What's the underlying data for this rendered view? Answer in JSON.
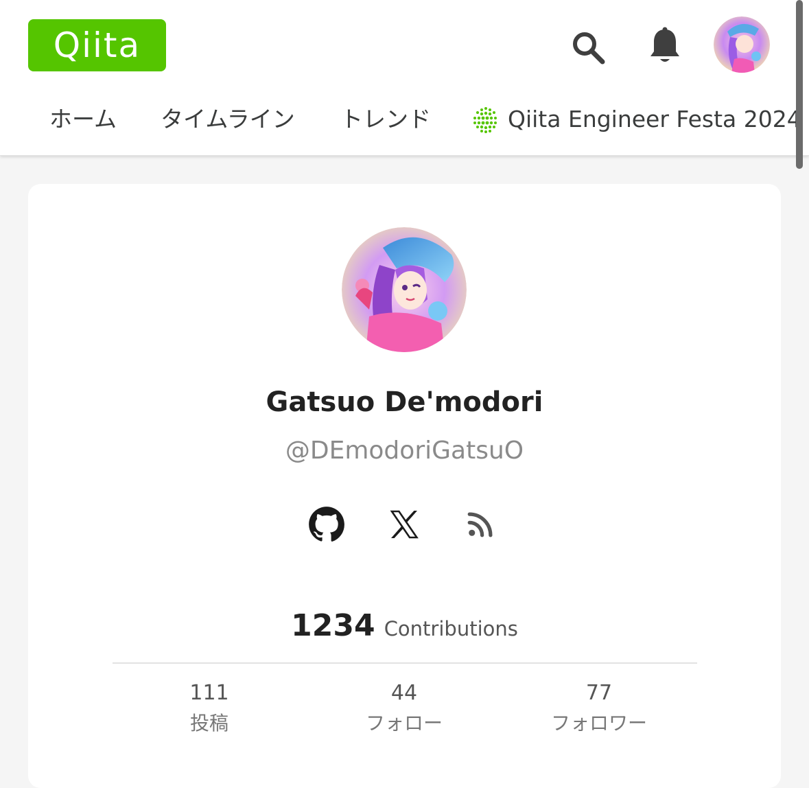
{
  "header": {
    "logo_text": "Qiita",
    "search_icon": "search-icon",
    "notification_icon": "bell-icon",
    "avatar_icon": "avatar"
  },
  "nav": {
    "items": [
      {
        "label": "ホーム"
      },
      {
        "label": "タイムライン"
      },
      {
        "label": "トレンド"
      },
      {
        "label": "Qiita Engineer Festa 2024",
        "icon": "festa-dot-icon"
      }
    ]
  },
  "profile": {
    "display_name": "Gatsuo De'modori",
    "handle": "@DEmodoriGatsuO",
    "social_links": [
      {
        "icon": "github-icon"
      },
      {
        "icon": "x-icon"
      },
      {
        "icon": "rss-icon"
      }
    ],
    "contributions": {
      "value": "1234",
      "label": "Contributions"
    },
    "stats": [
      {
        "value": "111",
        "label": "投稿"
      },
      {
        "value": "44",
        "label": "フォロー"
      },
      {
        "value": "77",
        "label": "フォロワー"
      }
    ]
  },
  "colors": {
    "brand": "#55c500",
    "text": "#222222",
    "muted": "#8a8a8a",
    "background": "#f5f5f5"
  }
}
